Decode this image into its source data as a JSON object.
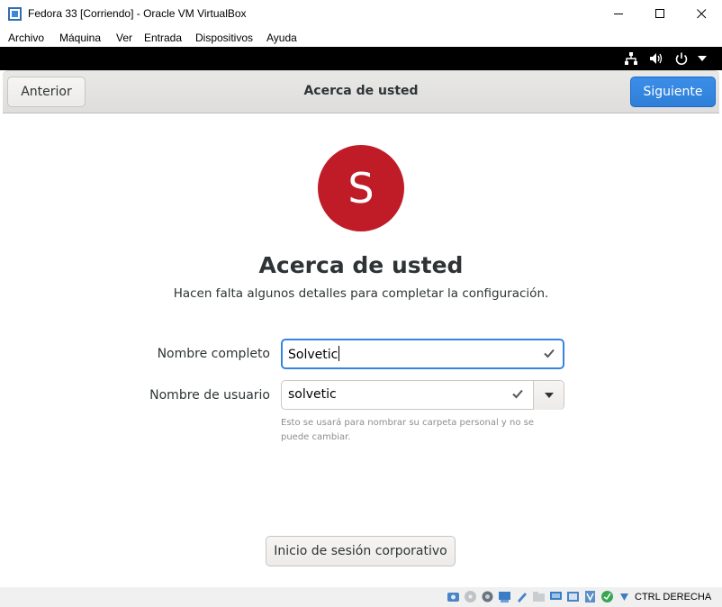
{
  "window": {
    "title": "Fedora 33 [Corriendo] - Oracle VM VirtualBox"
  },
  "menu": [
    "Archivo",
    "Máquina",
    "Ver",
    "Entrada",
    "Dispositivos",
    "Ayuda"
  ],
  "header": {
    "prev_label": "Anterior",
    "title": "Acerca de usted",
    "next_label": "Siguiente"
  },
  "main": {
    "avatar_letter": "S",
    "avatar_color": "#c01c28",
    "heading": "Acerca de usted",
    "subtitle": "Hacen falta algunos detalles para completar la configuración.",
    "full_name_label": "Nombre completo",
    "full_name_value": "Solvetic",
    "username_label": "Nombre de usuario",
    "username_value": "solvetic",
    "username_hint": "Esto se usará para nombrar su carpeta personal y no se puede cambiar.",
    "enterprise_login_label": "Inicio de sesión corporativo"
  },
  "statusbar": {
    "host_key": "CTRL DERECHA"
  },
  "colors": {
    "accent": "#3584e4",
    "suggested_button": "#3584e4"
  }
}
